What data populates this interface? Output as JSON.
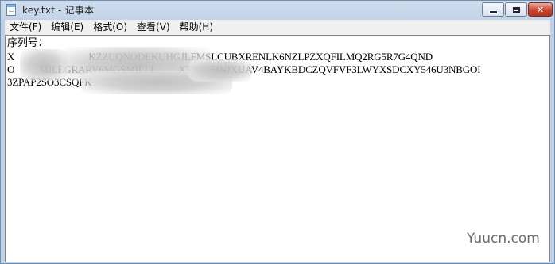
{
  "window": {
    "title": "key.txt - 记事本",
    "min_glyph": "",
    "max_glyph": "",
    "close_glyph": "✕"
  },
  "menu": [
    {
      "label": "文件(F)"
    },
    {
      "label": "编辑(E)"
    },
    {
      "label": "格式(O)"
    },
    {
      "label": "查看(V)"
    },
    {
      "label": "帮助(H)"
    }
  ],
  "document": {
    "label_line": "序列号：",
    "line1": "X                              KZZUQNODEKUHGJLFMSLCUBXRENLK6NZLPZXQFILMQ2RG5R7G4QND",
    "line2": "O          MILEGRARV6MGSMILLL         XTTJDEINJXUAV4BAYKBDCZQVFVF3LWYXSDCXY546U3NBGOI",
    "line3": "3ZPAP2SO3CSQFK"
  },
  "watermark": "Yuucn.com"
}
